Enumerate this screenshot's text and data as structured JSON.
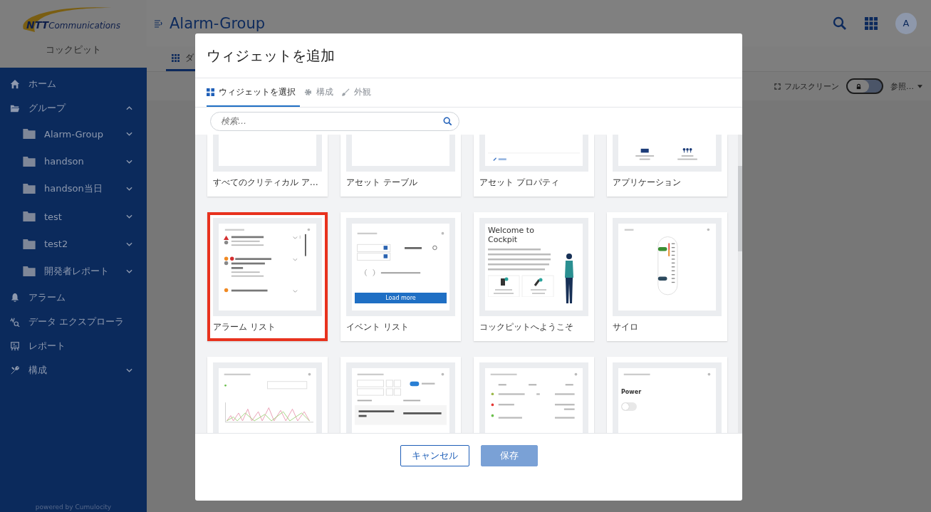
{
  "app": {
    "logo_strong": "NTT",
    "logo_rest": "Communications",
    "name": "コックピット",
    "footer": "powered by Cumulocity"
  },
  "sidebar": {
    "items": [
      {
        "label": "ホーム"
      },
      {
        "label": "グループ",
        "expanded": true,
        "children": [
          {
            "label": "Alarm-Group",
            "expanded": false
          },
          {
            "label": "handson",
            "expanded": false
          },
          {
            "label": "handson当日",
            "expanded": false
          },
          {
            "label": "test",
            "expanded": false
          },
          {
            "label": "test2",
            "expanded": false
          },
          {
            "label": "開発者レポート",
            "expanded": false
          }
        ]
      },
      {
        "label": "アラーム"
      },
      {
        "label": "データ エクスプローラ"
      },
      {
        "label": "レポート"
      },
      {
        "label": "構成",
        "expanded": false
      }
    ]
  },
  "header": {
    "title": "Alarm-Group",
    "avatar": "A"
  },
  "page_tabs": [
    {
      "label": "ダ",
      "selected": true
    }
  ],
  "toolbar": {
    "fullscreen": "フルスクリーン",
    "locked": true,
    "menu": "参照…"
  },
  "dialog": {
    "title": "ウィジェットを追加",
    "tabs": [
      {
        "label": "ウィジェットを選択",
        "selected": true
      },
      {
        "label": "構成",
        "selected": false
      },
      {
        "label": "外観",
        "selected": false
      }
    ],
    "search": {
      "placeholder": "検索…"
    },
    "widgets": [
      {
        "label": "すべてのクリティカル ア…",
        "kind": "blank",
        "selected": false
      },
      {
        "label": "アセット テーブル",
        "kind": "blank",
        "selected": false
      },
      {
        "label": "アセット プロパティ",
        "kind": "asset-props",
        "selected": false
      },
      {
        "label": "アプリケーション",
        "kind": "apps",
        "selected": false
      },
      {
        "label": "アラーム リスト",
        "kind": "alarm-list",
        "selected": true
      },
      {
        "label": "イベント リスト",
        "kind": "event-list",
        "selected": false,
        "preview": {
          "button": "Load more"
        }
      },
      {
        "label": "コックピットへようこそ",
        "kind": "welcome",
        "selected": false,
        "preview": {
          "heading": "Welcome to Cockpit"
        }
      },
      {
        "label": "サイロ",
        "kind": "silo",
        "selected": false
      },
      {
        "kind": "graph",
        "selected": false
      },
      {
        "kind": "table",
        "selected": false
      },
      {
        "kind": "dp-list",
        "selected": false,
        "preview": {
          "rows": [
            {
              "color": "#9cb84a"
            },
            {
              "color": "#e53935"
            },
            {
              "color": "#6abf4b"
            }
          ]
        }
      },
      {
        "kind": "fieldbus",
        "selected": false,
        "preview": {
          "field": "Power",
          "on": false
        }
      }
    ],
    "buttons": [
      {
        "label": "キャンセル",
        "kind": "secondary",
        "disabled": false
      },
      {
        "label": "保存",
        "kind": "primary",
        "disabled": true
      }
    ]
  }
}
